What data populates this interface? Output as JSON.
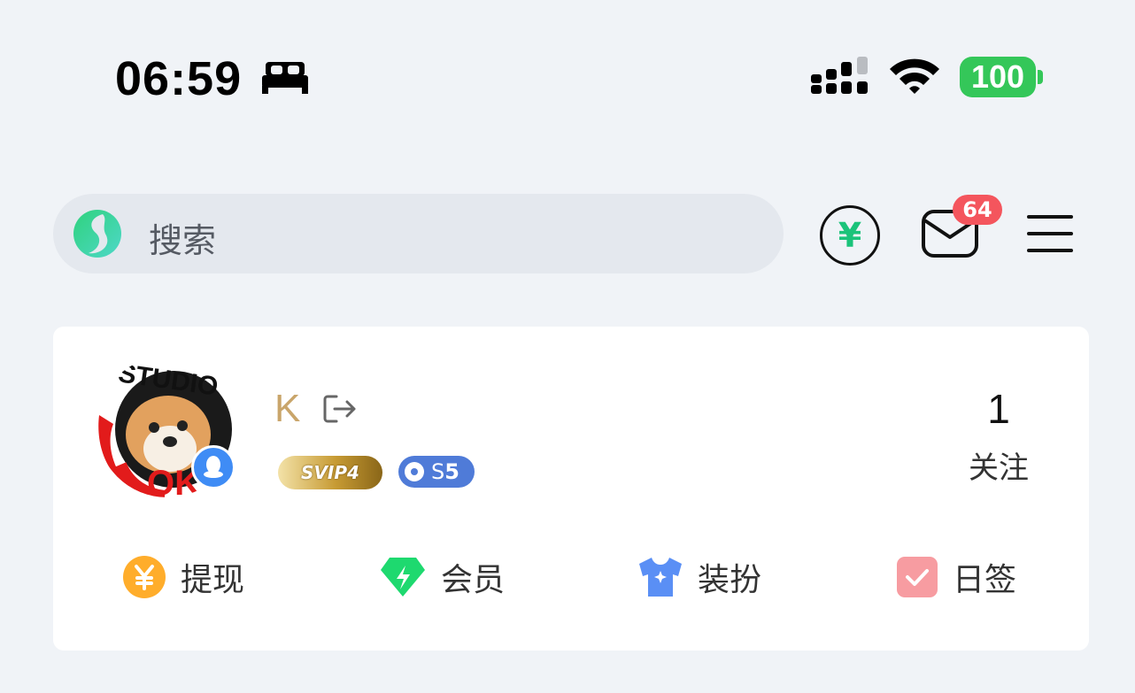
{
  "status_bar": {
    "time": "06:59",
    "focus_icon": "bed-icon",
    "battery": "100"
  },
  "search": {
    "placeholder": "搜索"
  },
  "header_actions": {
    "coin_symbol": "¥",
    "mail_badge": "64"
  },
  "profile": {
    "username": "K",
    "vip_badge": "SVIP4",
    "level_badge_prefix": "S",
    "level_badge_number": "5",
    "avatar_text": "STUDIO OK",
    "follow_count": "1",
    "follow_label": "关注"
  },
  "quick_actions": [
    {
      "label": "提现",
      "icon": "yen-coin-icon",
      "color": "#ffad2b"
    },
    {
      "label": "会员",
      "icon": "diamond-icon",
      "color": "#1ed96f"
    },
    {
      "label": "装扮",
      "icon": "tshirt-icon",
      "color": "#5a8ff5"
    },
    {
      "label": "日签",
      "icon": "checkmark-icon",
      "color": "#f79ca1"
    }
  ],
  "colors": {
    "background": "#f0f3f7",
    "accent_green": "#1bc37a",
    "badge_red": "#f4555d",
    "username_gold": "#c9a56a",
    "battery_green": "#34c759"
  }
}
